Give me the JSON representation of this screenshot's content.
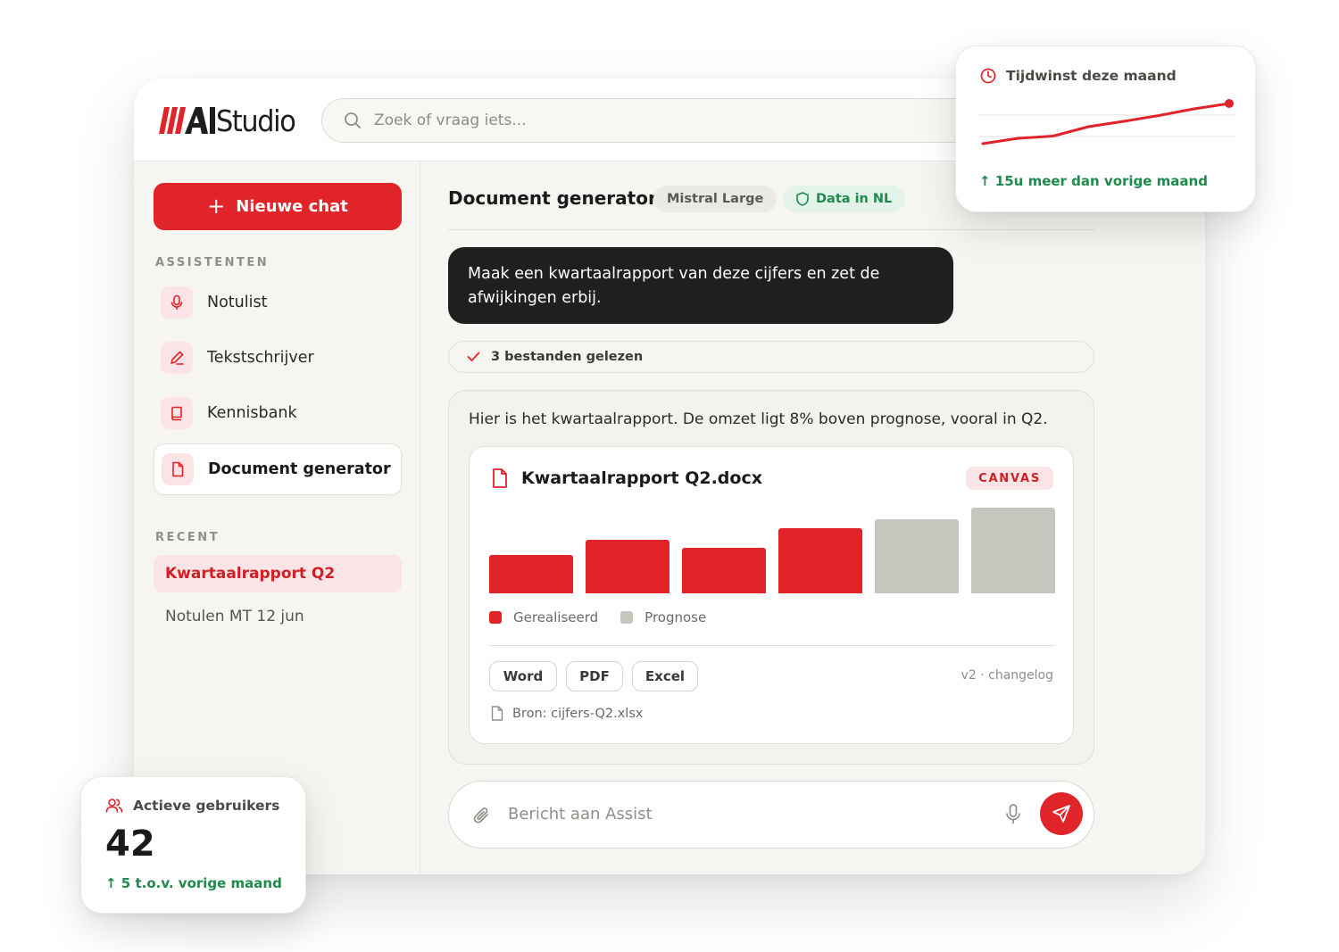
{
  "app": {
    "logo_text": "Studio",
    "logo_mark": "AI"
  },
  "search": {
    "placeholder": "Zoek of vraag iets..."
  },
  "sidebar": {
    "new_chat_label": "Nieuwe chat",
    "assistants_heading": "ASSISTENTEN",
    "assistants": [
      {
        "label": "Notulist",
        "icon": "microphone-icon"
      },
      {
        "label": "Tekstschrijver",
        "icon": "pen-icon"
      },
      {
        "label": "Kennisbank",
        "icon": "book-icon"
      },
      {
        "label": "Document generator",
        "icon": "document-icon",
        "active": true
      }
    ],
    "recent_heading": "RECENT",
    "recent": [
      {
        "label": "Kwartaalrapport Q2",
        "active": true
      },
      {
        "label": "Notulen MT 12 jun"
      }
    ]
  },
  "chat": {
    "title": "Document generator",
    "model_badge": "Mistral Large",
    "data_badge": "Data in NL",
    "user_message": "Maak een kwartaalrapport van deze cijfers en zet de afwijkingen erbij.",
    "files_status": "3 bestanden gelezen",
    "assistant_message": "Hier is het kwartaalrapport. De omzet ligt 8% boven prognose, vooral in Q2.",
    "document": {
      "filename": "Kwartaalrapport Q2.docx",
      "badge": "CANVAS",
      "exports": [
        "Word",
        "PDF",
        "Excel"
      ],
      "version": "v2 · changelog",
      "source": "Bron: cijfers-Q2.xlsx"
    },
    "composer_placeholder": "Bericht aan Assist"
  },
  "chart_data": {
    "type": "bar",
    "values": [
      45,
      62,
      53,
      76,
      86,
      100
    ],
    "series_per_bar": [
      "Gerealiseerd",
      "Gerealiseerd",
      "Gerealiseerd",
      "Gerealiseerd",
      "Prognose",
      "Prognose"
    ],
    "legend": [
      "Gerealiseerd",
      "Prognose"
    ],
    "ylim": [
      0,
      100
    ],
    "colors": {
      "Gerealiseerd": "#e1232a",
      "Prognose": "#c7c6be"
    }
  },
  "time_card": {
    "title": "Tijdwinst deze maand",
    "delta": "↑ 15u meer dan vorige maand",
    "sparkline": [
      10,
      22,
      27,
      48,
      60,
      73,
      88,
      100
    ]
  },
  "users_card": {
    "title": "Actieve gebruikers",
    "value": "42",
    "delta": "↑ 5 t.o.v. vorige maand"
  },
  "colors": {
    "accent": "#e1232a",
    "accent_soft": "#fbe4e5",
    "positive": "#1f8a4c",
    "dark_bubble": "#1f1f1f"
  }
}
